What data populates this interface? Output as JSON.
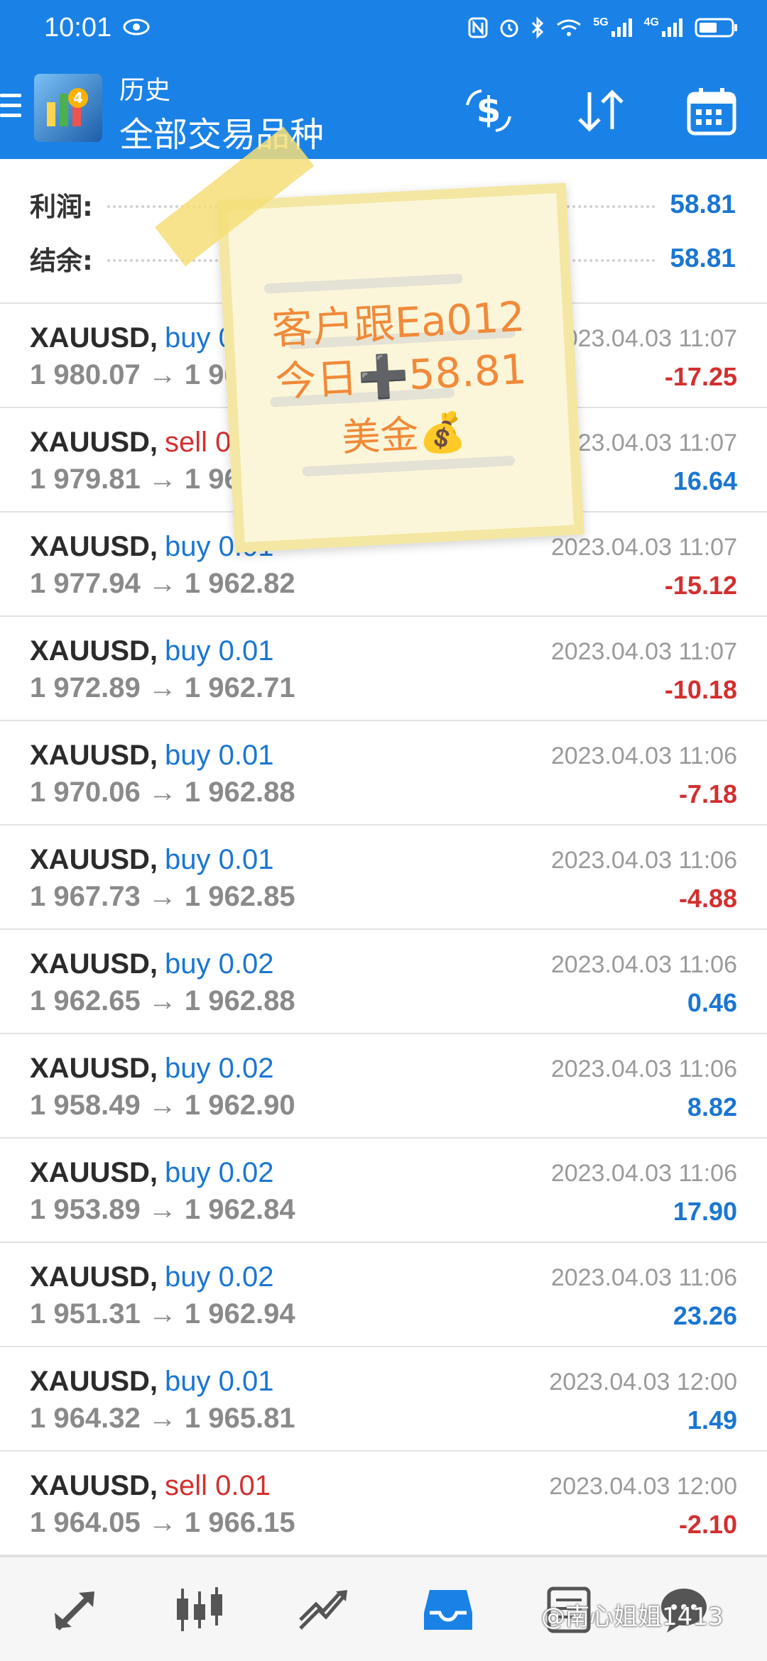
{
  "status_bar": {
    "time": "10:01",
    "signal_5g": "5G",
    "signal_4g": "4G"
  },
  "app_bar": {
    "subtitle": "历史",
    "title": "全部交易品种"
  },
  "summary": {
    "profit_label": "利润:",
    "profit_value": "58.81",
    "balance_label": "结余:",
    "balance_value": "58.81"
  },
  "trades": [
    {
      "symbol": "XAUUSD,",
      "side": "buy",
      "side_text": "buy 0.01",
      "prices": "1 980.07 → 1 962.82",
      "time": "2023.04.03 11:07",
      "profit": "-17.25",
      "sign": "neg"
    },
    {
      "symbol": "XAUUSD,",
      "side": "sell",
      "side_text": "sell 0.01",
      "prices": "1 979.81 → 1 963.17",
      "time": "2023.04.03 11:07",
      "profit": "16.64",
      "sign": "pos"
    },
    {
      "symbol": "XAUUSD,",
      "side": "buy",
      "side_text": "buy 0.01",
      "prices": "1 977.94 → 1 962.82",
      "time": "2023.04.03 11:07",
      "profit": "-15.12",
      "sign": "neg"
    },
    {
      "symbol": "XAUUSD,",
      "side": "buy",
      "side_text": "buy 0.01",
      "prices": "1 972.89 → 1 962.71",
      "time": "2023.04.03 11:07",
      "profit": "-10.18",
      "sign": "neg"
    },
    {
      "symbol": "XAUUSD,",
      "side": "buy",
      "side_text": "buy 0.01",
      "prices": "1 970.06 → 1 962.88",
      "time": "2023.04.03 11:06",
      "profit": "-7.18",
      "sign": "neg"
    },
    {
      "symbol": "XAUUSD,",
      "side": "buy",
      "side_text": "buy 0.01",
      "prices": "1 967.73 → 1 962.85",
      "time": "2023.04.03 11:06",
      "profit": "-4.88",
      "sign": "neg"
    },
    {
      "symbol": "XAUUSD,",
      "side": "buy",
      "side_text": "buy 0.02",
      "prices": "1 962.65 → 1 962.88",
      "time": "2023.04.03 11:06",
      "profit": "0.46",
      "sign": "pos"
    },
    {
      "symbol": "XAUUSD,",
      "side": "buy",
      "side_text": "buy 0.02",
      "prices": "1 958.49 → 1 962.90",
      "time": "2023.04.03 11:06",
      "profit": "8.82",
      "sign": "pos"
    },
    {
      "symbol": "XAUUSD,",
      "side": "buy",
      "side_text": "buy 0.02",
      "prices": "1 953.89 → 1 962.84",
      "time": "2023.04.03 11:06",
      "profit": "17.90",
      "sign": "pos"
    },
    {
      "symbol": "XAUUSD,",
      "side": "buy",
      "side_text": "buy 0.02",
      "prices": "1 951.31 → 1 962.94",
      "time": "2023.04.03 11:06",
      "profit": "23.26",
      "sign": "pos"
    },
    {
      "symbol": "XAUUSD,",
      "side": "buy",
      "side_text": "buy 0.01",
      "prices": "1 964.32 → 1 965.81",
      "time": "2023.04.03 12:00",
      "profit": "1.49",
      "sign": "pos"
    },
    {
      "symbol": "XAUUSD,",
      "side": "sell",
      "side_text": "sell 0.01",
      "prices": "1 964.05 → 1 966.15",
      "time": "2023.04.03 12:00",
      "profit": "-2.10",
      "sign": "neg"
    }
  ],
  "sticky_note": {
    "line1": "客户跟Ea012",
    "line2": "今日➕58.81",
    "line3": "美金💰"
  },
  "bottom_nav": {
    "items": [
      "quotes-icon",
      "chart-icon",
      "trade-icon",
      "history-icon",
      "news-icon",
      "chat-icon"
    ],
    "active": "history-icon",
    "watermark": "@南心姐姐1413"
  },
  "colors": {
    "accent": "#1a82e6",
    "positive": "#1a76d2",
    "negative": "#d32f2f",
    "note_text": "#f08a3a"
  }
}
